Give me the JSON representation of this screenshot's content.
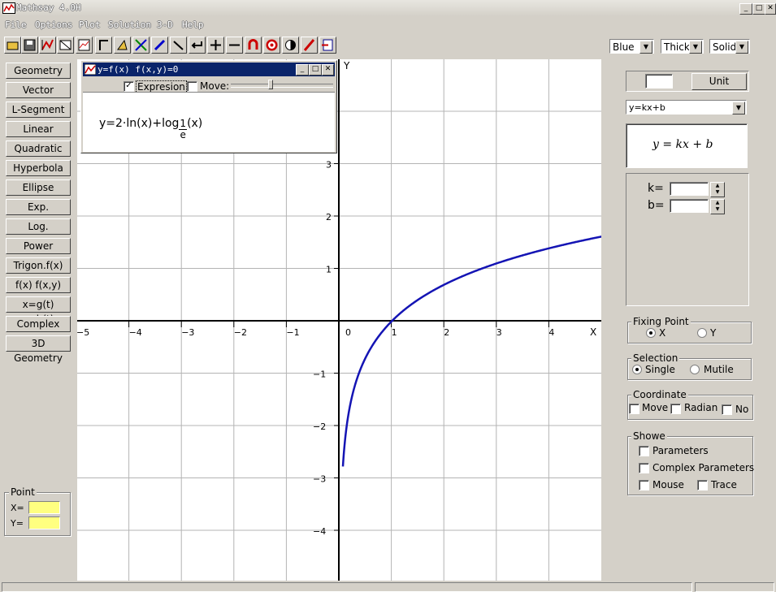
{
  "window": {
    "title": "Mathsay 4.0H"
  },
  "menu": [
    "File",
    "Options",
    "Plot",
    "Solution",
    "3-D",
    "Help"
  ],
  "toolbar_icons": [
    "open-icon",
    "save-icon",
    "plot-icon",
    "image-icon",
    "chart-icon",
    "corner-icon",
    "triangle-icon",
    "cross-icon",
    "pen-icon",
    "line-icon",
    "arrow-left-icon",
    "plus-icon",
    "minus-icon",
    "magnet-icon",
    "target-icon",
    "contrast-icon",
    "pencil-icon",
    "exit-icon"
  ],
  "style_selects": {
    "color": "Blue",
    "width": "Thick",
    "line": "Solid"
  },
  "left_buttons": [
    "Geometry",
    "Vector",
    "L-Segment",
    "Linear",
    "Quadratic",
    "Hyperbola",
    "Ellipse",
    "Exp.",
    "Log.",
    "Power",
    "Trigon.f(x)",
    "f(x)  f(x,y)",
    "x=g(t) y=h(t)",
    "Complex",
    "3D Geometry"
  ],
  "point_box": {
    "label": "Point",
    "x_label": "X=",
    "y_label": "Y="
  },
  "subwindow": {
    "title": "y=f(x)  f(x,y)=0",
    "expression_label": "Expresion",
    "expression_checked": true,
    "move_label": "Move:",
    "move_checked": false,
    "formula_main": "y=2·ln(x)+log",
    "formula_base_top": "1",
    "formula_base_bottom": "e",
    "formula_tail": "(x)"
  },
  "axes": {
    "x_label": "X",
    "y_label": "Y",
    "x_ticks": [
      "−5",
      "−4",
      "−3",
      "−2",
      "−1",
      "0",
      "1",
      "2",
      "3",
      "4"
    ],
    "y_ticks_pos": [
      "3",
      "2",
      "1"
    ],
    "y_ticks_neg": [
      "−1",
      "−2",
      "−3",
      "−4"
    ]
  },
  "right_panel": {
    "unit_button": "Unit",
    "function_select": "y=kx+b",
    "formula_display": "y = kx + b",
    "param_k": "k=",
    "param_b": "b=",
    "fixing_point": {
      "legend": "Fixing Point",
      "x": "X",
      "y": "Y",
      "selected": "X"
    },
    "selection": {
      "legend": "Selection",
      "single": "Single",
      "mutile": "Mutile",
      "selected": "Single"
    },
    "coordinate": {
      "legend": "Coordinate",
      "move": "Move",
      "radian": "Radian",
      "no": "No"
    },
    "showe": {
      "legend": "Showe",
      "parameters": "Parameters",
      "complex_parameters": "Complex Parameters",
      "mouse": "Mouse",
      "trace": "Trace"
    }
  },
  "colors": {
    "curve": "#1414b4",
    "title_active": "#0a246a",
    "point_field": "#ffff80"
  }
}
